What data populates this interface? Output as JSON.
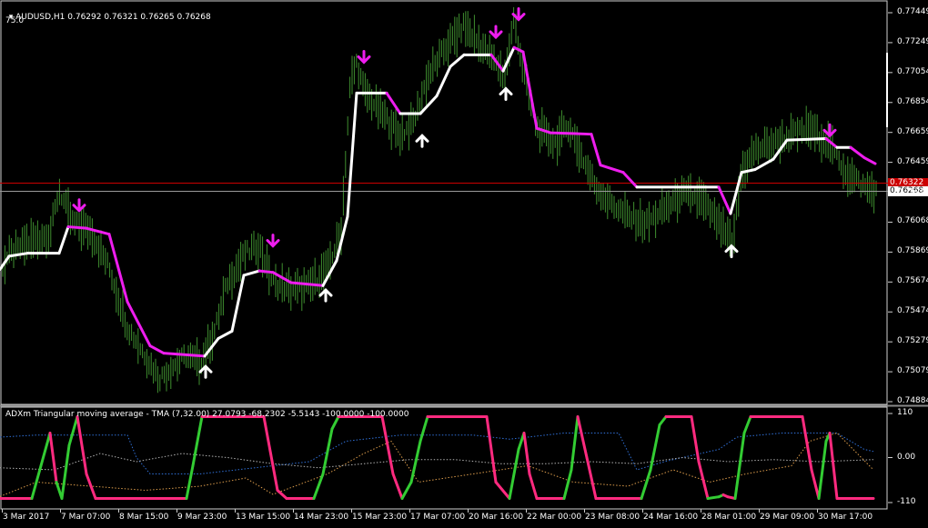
{
  "main_header": {
    "symbol_tf": "AUDUSD,H1",
    "ohlc": "0.76292 0.76321 0.76265 0.76268",
    "extra": "75.0"
  },
  "indicator_header": "ADXm Triangular moving average - TMA (7,32.00) 27.0793 -68.2302 -5.5143 -100.0000 -100.0000",
  "price_axis": [
    "0.77449",
    "0.77249",
    "0.77054",
    "0.76854",
    "0.76659",
    "0.76459",
    "0.76268",
    "0.76068",
    "0.75869",
    "0.75674",
    "0.75474",
    "0.75279",
    "0.75079",
    "0.74884"
  ],
  "current_price_tag": "0.76268",
  "bid_tag": "0.76322",
  "indicator_axis": [
    "110",
    "0.00",
    "-110"
  ],
  "time_axis": [
    "3 Mar 2017",
    "7 Mar 07:00",
    "8 Mar 15:00",
    "9 Mar 23:00",
    "13 Mar 15:00",
    "14 Mar 23:00",
    "15 Mar 23:00",
    "17 Mar 07:00",
    "20 Mar 16:00",
    "22 Mar 00:00",
    "23 Mar 08:00",
    "24 Mar 16:00",
    "28 Mar 01:00",
    "29 Mar 09:00",
    "30 Mar 17:00"
  ],
  "colors": {
    "background": "#000000",
    "candles": "#3f8f2f",
    "tma_up": "#ffffff",
    "tma_down": "#ee1dee",
    "adx_up": "#33cc33",
    "adx_down": "#ff2a7f",
    "bid_line": "#cc0000",
    "ask_line": "#9a9a9a",
    "dotted_blue": "#2f6fd6",
    "dotted_orange": "#d99a4a",
    "dotted_gray": "#b0b0b0"
  },
  "chart_data": [
    {
      "type": "line",
      "symbol": "AUDUSD",
      "timeframe": "H1",
      "x": [
        "3 Mar 2017",
        "7 Mar 07:00",
        "8 Mar 15:00",
        "9 Mar 23:00",
        "13 Mar 15:00",
        "14 Mar 23:00",
        "15 Mar 23:00",
        "17 Mar 07:00",
        "20 Mar 16:00",
        "22 Mar 00:00",
        "23 Mar 08:00",
        "24 Mar 16:00",
        "28 Mar 01:00",
        "29 Mar 09:00",
        "30 Mar 17:00"
      ],
      "price_path": [
        [
          0,
          0.7572
        ],
        [
          10,
          0.7584
        ],
        [
          30,
          0.7592
        ],
        [
          55,
          0.7598
        ],
        [
          65,
          0.7628
        ],
        [
          80,
          0.7605
        ],
        [
          100,
          0.76
        ],
        [
          120,
          0.7575
        ],
        [
          140,
          0.7535
        ],
        [
          160,
          0.7515
        ],
        [
          175,
          0.75
        ],
        [
          190,
          0.7508
        ],
        [
          205,
          0.7515
        ],
        [
          220,
          0.751
        ],
        [
          235,
          0.753
        ],
        [
          250,
          0.7565
        ],
        [
          270,
          0.7585
        ],
        [
          285,
          0.759
        ],
        [
          300,
          0.7565
        ],
        [
          320,
          0.756
        ],
        [
          340,
          0.7562
        ],
        [
          360,
          0.7575
        ],
        [
          375,
          0.76
        ],
        [
          385,
          0.77
        ],
        [
          392,
          0.7715
        ],
        [
          400,
          0.7695
        ],
        [
          420,
          0.768
        ],
        [
          440,
          0.7665
        ],
        [
          455,
          0.7675
        ],
        [
          470,
          0.7705
        ],
        [
          490,
          0.7725
        ],
        [
          510,
          0.774
        ],
        [
          530,
          0.7725
        ],
        [
          545,
          0.7715
        ],
        [
          555,
          0.7705
        ],
        [
          565,
          0.7745
        ],
        [
          575,
          0.771
        ],
        [
          590,
          0.767
        ],
        [
          610,
          0.766
        ],
        [
          625,
          0.7672
        ],
        [
          640,
          0.765
        ],
        [
          655,
          0.763
        ],
        [
          670,
          0.762
        ],
        [
          690,
          0.761
        ],
        [
          710,
          0.7605
        ],
        [
          730,
          0.7615
        ],
        [
          750,
          0.7625
        ],
        [
          770,
          0.7622
        ],
        [
          790,
          0.7605
        ],
        [
          805,
          0.759
        ],
        [
          815,
          0.764
        ],
        [
          830,
          0.7655
        ],
        [
          850,
          0.766
        ],
        [
          870,
          0.7665
        ],
        [
          890,
          0.767
        ],
        [
          910,
          0.766
        ],
        [
          930,
          0.764
        ],
        [
          950,
          0.763
        ],
        [
          962,
          0.7627
        ]
      ],
      "tma_line": [
        [
          0,
          0.7574
        ],
        [
          10,
          0.7583
        ],
        [
          30,
          0.7585
        ],
        [
          65,
          0.7585
        ],
        [
          75,
          0.7603
        ],
        [
          95,
          0.7602
        ],
        [
          120,
          0.7598
        ],
        [
          140,
          0.7552
        ],
        [
          165,
          0.7522
        ],
        [
          180,
          0.7517
        ],
        [
          225,
          0.7515
        ],
        [
          240,
          0.7527
        ],
        [
          255,
          0.7532
        ],
        [
          268,
          0.757
        ],
        [
          285,
          0.7573
        ],
        [
          300,
          0.7572
        ],
        [
          320,
          0.7565
        ],
        [
          355,
          0.7563
        ],
        [
          370,
          0.758
        ],
        [
          382,
          0.761
        ],
        [
          392,
          0.7694
        ],
        [
          425,
          0.7694
        ],
        [
          440,
          0.768
        ],
        [
          462,
          0.768
        ],
        [
          480,
          0.7692
        ],
        [
          495,
          0.7712
        ],
        [
          510,
          0.772
        ],
        [
          540,
          0.772
        ],
        [
          553,
          0.7709
        ],
        [
          565,
          0.7725
        ],
        [
          575,
          0.7722
        ],
        [
          590,
          0.767
        ],
        [
          605,
          0.7667
        ],
        [
          650,
          0.7666
        ],
        [
          660,
          0.7645
        ],
        [
          685,
          0.764
        ],
        [
          700,
          0.763
        ],
        [
          790,
          0.763
        ],
        [
          803,
          0.7612
        ],
        [
          815,
          0.764
        ],
        [
          830,
          0.7642
        ],
        [
          850,
          0.7649
        ],
        [
          865,
          0.7662
        ],
        [
          908,
          0.7663
        ],
        [
          920,
          0.7657
        ],
        [
          935,
          0.7657
        ],
        [
          950,
          0.765
        ],
        [
          962,
          0.7646
        ]
      ],
      "signals": {
        "sell_arrows": [
          [
            87,
            0.7614
          ],
          [
            300,
            0.759
          ],
          [
            400,
            0.7715
          ],
          [
            545,
            0.7732
          ],
          [
            570,
            0.7744
          ],
          [
            912,
            0.7665
          ]
        ],
        "buy_arrows": [
          [
            226,
            0.7508
          ],
          [
            358,
            0.756
          ],
          [
            464,
            0.7665
          ],
          [
            556,
            0.7697
          ],
          [
            804,
            0.759
          ]
        ]
      },
      "ylim": [
        0.7484,
        0.7753
      ]
    },
    {
      "type": "line",
      "title": "ADXm Triangular moving average - TMA (7,32.00)",
      "values": [
        27.0793,
        -68.2302,
        -5.5143,
        -100.0,
        -100.0
      ],
      "ylim": [
        -110,
        110
      ],
      "oscillator": [
        [
          0,
          -100
        ],
        [
          10,
          -100
        ],
        [
          35,
          -100
        ],
        [
          45,
          -20
        ],
        [
          55,
          60
        ],
        [
          62,
          -60
        ],
        [
          68,
          -100
        ],
        [
          76,
          30
        ],
        [
          85,
          100
        ],
        [
          95,
          -40
        ],
        [
          105,
          -100
        ],
        [
          205,
          -100
        ],
        [
          212,
          -20
        ],
        [
          222,
          100
        ],
        [
          290,
          100
        ],
        [
          305,
          -80
        ],
        [
          315,
          -100
        ],
        [
          345,
          -100
        ],
        [
          355,
          -40
        ],
        [
          365,
          70
        ],
        [
          372,
          100
        ],
        [
          420,
          100
        ],
        [
          432,
          -40
        ],
        [
          442,
          -100
        ],
        [
          452,
          -60
        ],
        [
          462,
          40
        ],
        [
          470,
          100
        ],
        [
          535,
          100
        ],
        [
          545,
          -60
        ],
        [
          560,
          -100
        ],
        [
          570,
          20
        ],
        [
          576,
          60
        ],
        [
          582,
          -40
        ],
        [
          590,
          -100
        ],
        [
          620,
          -100
        ],
        [
          628,
          -30
        ],
        [
          635,
          100
        ],
        [
          645,
          0
        ],
        [
          655,
          -100
        ],
        [
          705,
          -100
        ],
        [
          715,
          -30
        ],
        [
          725,
          80
        ],
        [
          732,
          100
        ],
        [
          760,
          100
        ],
        [
          768,
          -10
        ],
        [
          778,
          -100
        ],
        [
          790,
          -96
        ],
        [
          795,
          -91
        ],
        [
          800,
          -96
        ],
        [
          808,
          -100
        ],
        [
          818,
          60
        ],
        [
          825,
          100
        ],
        [
          882,
          100
        ],
        [
          892,
          -30
        ],
        [
          900,
          -100
        ],
        [
          908,
          40
        ],
        [
          912,
          60
        ],
        [
          920,
          -100
        ],
        [
          960,
          -100
        ]
      ],
      "rising_segments": [
        [
          35,
          55
        ],
        [
          62,
          85
        ],
        [
          205,
          222
        ],
        [
          345,
          372
        ],
        [
          442,
          470
        ],
        [
          560,
          576
        ],
        [
          620,
          635
        ],
        [
          705,
          732
        ],
        [
          778,
          795
        ],
        [
          808,
          825
        ],
        [
          900,
          912
        ]
      ],
      "dotted_series": {
        "blue": [
          [
            0,
            50
          ],
          [
            40,
            55
          ],
          [
            80,
            55
          ],
          [
            140,
            55
          ],
          [
            150,
            0
          ],
          [
            165,
            -40
          ],
          [
            220,
            -40
          ],
          [
            260,
            -30
          ],
          [
            300,
            -20
          ],
          [
            340,
            -10
          ],
          [
            380,
            40
          ],
          [
            440,
            55
          ],
          [
            520,
            55
          ],
          [
            560,
            45
          ],
          [
            620,
            60
          ],
          [
            680,
            60
          ],
          [
            700,
            -30
          ],
          [
            730,
            -10
          ],
          [
            790,
            20
          ],
          [
            810,
            50
          ],
          [
            860,
            60
          ],
          [
            920,
            60
          ],
          [
            950,
            20
          ],
          [
            960,
            15
          ]
        ],
        "orange": [
          [
            0,
            -95
          ],
          [
            40,
            -60
          ],
          [
            100,
            -70
          ],
          [
            160,
            -80
          ],
          [
            220,
            -70
          ],
          [
            270,
            -50
          ],
          [
            300,
            -90
          ],
          [
            360,
            -40
          ],
          [
            400,
            10
          ],
          [
            430,
            40
          ],
          [
            460,
            -60
          ],
          [
            520,
            -40
          ],
          [
            580,
            -20
          ],
          [
            630,
            -60
          ],
          [
            690,
            -70
          ],
          [
            740,
            -30
          ],
          [
            780,
            -60
          ],
          [
            820,
            -40
          ],
          [
            870,
            -20
          ],
          [
            890,
            40
          ],
          [
            920,
            60
          ],
          [
            960,
            -30
          ]
        ],
        "gray": [
          [
            0,
            -25
          ],
          [
            60,
            -30
          ],
          [
            110,
            10
          ],
          [
            150,
            -10
          ],
          [
            200,
            10
          ],
          [
            250,
            0
          ],
          [
            300,
            -15
          ],
          [
            350,
            -25
          ],
          [
            400,
            -15
          ],
          [
            450,
            -5
          ],
          [
            500,
            -5
          ],
          [
            550,
            -15
          ],
          [
            600,
            -15
          ],
          [
            650,
            -10
          ],
          [
            700,
            -15
          ],
          [
            750,
            0
          ],
          [
            800,
            -10
          ],
          [
            850,
            -5
          ],
          [
            900,
            -10
          ],
          [
            960,
            -5
          ]
        ]
      }
    }
  ]
}
